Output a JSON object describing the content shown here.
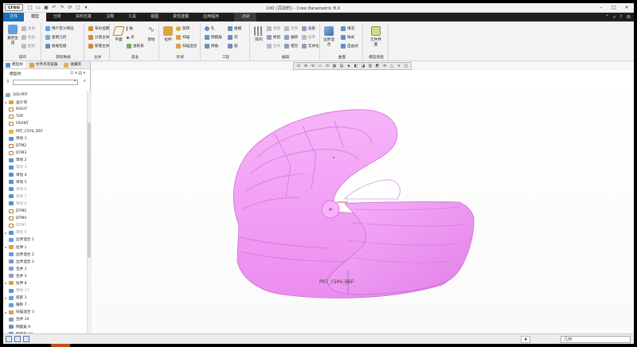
{
  "app": {
    "logo": "creo",
    "window_title": "100 (活动的) - Creo Parametric 8.0"
  },
  "ribbon_tabs": [
    {
      "label": "文件"
    },
    {
      "label": "模型"
    },
    {
      "label": "分析"
    },
    {
      "label": "实时仿真"
    },
    {
      "label": "注释"
    },
    {
      "label": "工具"
    },
    {
      "label": "视图"
    },
    {
      "label": "柔性建模"
    },
    {
      "label": "应用程序"
    },
    {
      "label": "渲染"
    }
  ],
  "ribbon": {
    "g1": {
      "name": "操作",
      "regen": "重新生成",
      "copy": "复制",
      "paste": "粘贴",
      "delete": "删除"
    },
    "g2": {
      "name": "获取数据",
      "udf": "用户定义特征",
      "copygeom": "复制几何",
      "shrinkwrap": "收缩包络"
    },
    "g3": {
      "name": "主体",
      "boolean": "布尔运算",
      "split": "分割主体",
      "newbody": "新建主体"
    },
    "g4": {
      "name": "基准",
      "plane": "平面",
      "axis": "轴",
      "point": "点",
      "csys": "坐标系",
      "sketch": "草绘"
    },
    "g5": {
      "name": "形状",
      "extrude": "拉伸",
      "revolve": "旋转",
      "sweep": "扫描",
      "swept_blend": "扫描混合"
    },
    "g6": {
      "name": "工程",
      "hole": "孔",
      "round": "倒圆角",
      "chamfer": "倒角",
      "draft": "拔模",
      "shell": "壳",
      "rib": "筋"
    },
    "g7": {
      "name": "编辑",
      "array": "阵列",
      "mirror": "镜像",
      "extend": "延伸",
      "trim": "修剪",
      "offset": "偏移",
      "merge": "合并",
      "intersect": "相交",
      "thicken": "加厚",
      "project": "投影",
      "solidify": "实体化"
    },
    "g8": {
      "name": "曲面",
      "boundary": "边界混合",
      "fill": "填充",
      "style": "样式",
      "freeform": "自由式"
    },
    "g9": {
      "name": "模型意图",
      "element": "元件界面"
    }
  },
  "panel": {
    "tabs": [
      "模型树",
      "文件夹浏览器",
      "收藏夹"
    ],
    "tree_title": "模型树"
  },
  "tree": [
    {
      "label": "100.PRT",
      "type": "root",
      "exp": "",
      "dim": false
    },
    {
      "label": "设计项",
      "type": "folder",
      "exp": "▸",
      "dim": false
    },
    {
      "label": "RIGHT",
      "type": "plane",
      "exp": "",
      "dim": false
    },
    {
      "label": "TOP",
      "type": "plane",
      "exp": "",
      "dim": false
    },
    {
      "label": "FRONT",
      "type": "plane",
      "exp": "",
      "dim": false
    },
    {
      "label": "PRT_CSYS_DEF",
      "type": "csys",
      "exp": "",
      "dim": false
    },
    {
      "label": "草绘 1",
      "type": "sketch",
      "exp": "",
      "dim": false
    },
    {
      "label": "DTM2",
      "type": "plane",
      "exp": "",
      "dim": false
    },
    {
      "label": "DTM3",
      "type": "plane",
      "exp": "",
      "dim": false
    },
    {
      "label": "草绘 2",
      "type": "sketch",
      "exp": "",
      "dim": false
    },
    {
      "label": "草绘 3",
      "type": "sketch",
      "exp": "",
      "dim": true
    },
    {
      "label": "草绘 4",
      "type": "sketch",
      "exp": "",
      "dim": false
    },
    {
      "label": "草绘 5",
      "type": "sketch",
      "exp": "",
      "dim": false
    },
    {
      "label": "草绘 6",
      "type": "sketch",
      "exp": "",
      "dim": true
    },
    {
      "label": "草绘 7",
      "type": "sketch",
      "exp": "",
      "dim": true
    },
    {
      "label": "草绘 8",
      "type": "sketch",
      "exp": "",
      "dim": true
    },
    {
      "label": "DTM5",
      "type": "plane",
      "exp": "",
      "dim": false
    },
    {
      "label": "DTM4",
      "type": "plane",
      "exp": "",
      "dim": false
    },
    {
      "label": "DTM7",
      "type": "plane",
      "exp": "",
      "dim": true
    },
    {
      "label": "草绘 9",
      "type": "sketch",
      "exp": "▸",
      "dim": true
    },
    {
      "label": "边界混合 1",
      "type": "surface",
      "exp": "",
      "dim": false
    },
    {
      "label": "拉伸 1",
      "type": "extrude",
      "exp": "▸",
      "dim": false
    },
    {
      "label": "边界混合 2",
      "type": "surface",
      "exp": "",
      "dim": false
    },
    {
      "label": "边界混合 3",
      "type": "surface",
      "exp": "",
      "dim": false
    },
    {
      "label": "合并 1",
      "type": "merge",
      "exp": "",
      "dim": false
    },
    {
      "label": "合并 2",
      "type": "merge",
      "exp": "",
      "dim": false
    },
    {
      "label": "拉伸 8",
      "type": "extrude",
      "exp": "▸",
      "dim": false
    },
    {
      "label": "草绘 17",
      "type": "sketch",
      "exp": "",
      "dim": true
    },
    {
      "label": "投影 1",
      "type": "project",
      "exp": "▸",
      "dim": false
    },
    {
      "label": "偏移 7",
      "type": "offset",
      "exp": "",
      "dim": false
    },
    {
      "label": "扫描混合 3",
      "type": "sweep",
      "exp": "▸",
      "dim": false
    },
    {
      "label": "合并 10",
      "type": "merge",
      "exp": "",
      "dim": false
    },
    {
      "label": "倒圆角 9",
      "type": "round",
      "exp": "",
      "dim": false
    },
    {
      "label": "倒圆角 10",
      "type": "round",
      "exp": "",
      "dim": false
    }
  ],
  "viewport": {
    "csys_label": "PRT_CSYS_DEF",
    "model_color": "#f39cf6"
  },
  "status": {
    "smart_label": "几何",
    "filter_glyph": "♦"
  },
  "colors": {
    "file_tab": "#1b6fb8",
    "model_pink": "#f39cf6",
    "model_shadow": "#c86fd0"
  }
}
